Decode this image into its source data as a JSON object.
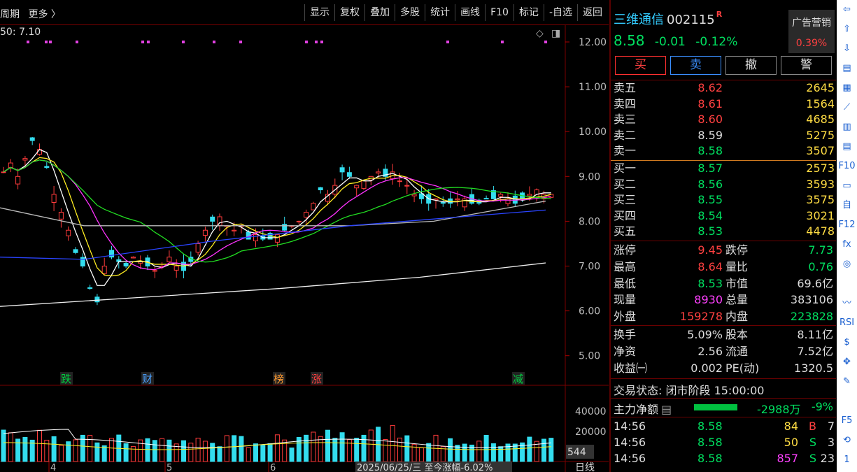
{
  "topbar": {
    "left_items": [
      "周期",
      "更多 〉"
    ],
    "tools": [
      "显示",
      "复权",
      "叠加",
      "多股",
      "统计",
      "画线",
      "F10",
      "标记",
      "-自选",
      "返回"
    ]
  },
  "chart": {
    "ma_readout": "50: 7.10",
    "price_axis": [
      "12.00",
      "11.00",
      "10.00",
      "9.00",
      "8.00",
      "7.00",
      "6.00",
      "5.00"
    ],
    "volume_axis": [
      "40000",
      "20000"
    ],
    "volume_current": "544",
    "x_labels": [
      "4",
      "5",
      "6"
    ],
    "date_readout": "2025/06/25/三  至今涨幅-6.02%",
    "period": "日线",
    "event_markers": [
      {
        "label": "跌",
        "color": "#00d040"
      },
      {
        "label": "财",
        "color": "#4aa0ff"
      },
      {
        "label": "榜",
        "color": "#ff9a30"
      },
      {
        "label": "涨",
        "color": "#ff4040"
      },
      {
        "label": "减",
        "color": "#00d040"
      }
    ]
  },
  "quote": {
    "name": "三维通信",
    "code": "002115",
    "r_mark": "R",
    "price": "8.58",
    "change": "-0.01",
    "change_pct": "-0.12%",
    "ad_label": "广告营销",
    "ad_pct": "0.39%",
    "buttons": [
      "买",
      "卖",
      "撤",
      "警"
    ]
  },
  "order_book": {
    "asks": [
      {
        "label": "卖五",
        "price": "8.62",
        "vol": "2645",
        "color": "#ff4040"
      },
      {
        "label": "卖四",
        "price": "8.61",
        "vol": "1564",
        "color": "#ff4040"
      },
      {
        "label": "卖三",
        "price": "8.60",
        "vol": "4685",
        "color": "#ff4040"
      },
      {
        "label": "卖二",
        "price": "8.59",
        "vol": "5275",
        "color": "#dddddd"
      },
      {
        "label": "卖一",
        "price": "8.58",
        "vol": "3507",
        "color": "#00e060"
      }
    ],
    "bids": [
      {
        "label": "买一",
        "price": "8.57",
        "vol": "2573",
        "color": "#00e060"
      },
      {
        "label": "买二",
        "price": "8.56",
        "vol": "3593",
        "color": "#00e060"
      },
      {
        "label": "买三",
        "price": "8.55",
        "vol": "3575",
        "color": "#00e060"
      },
      {
        "label": "买四",
        "price": "8.54",
        "vol": "3021",
        "color": "#00e060"
      },
      {
        "label": "买五",
        "price": "8.53",
        "vol": "4478",
        "color": "#00e060"
      }
    ]
  },
  "stats": [
    [
      {
        "k": "涨停",
        "v": "9.45",
        "c": "#ff4040"
      },
      {
        "k": "跌停",
        "v": "7.73",
        "c": "#00e060"
      }
    ],
    [
      {
        "k": "最高",
        "v": "8.64",
        "c": "#ff4040"
      },
      {
        "k": "量比",
        "v": "0.76",
        "c": "#00e060"
      }
    ],
    [
      {
        "k": "最低",
        "v": "8.53",
        "c": "#00e060"
      },
      {
        "k": "市值",
        "v": "69.6亿",
        "c": "#dddddd"
      }
    ],
    [
      {
        "k": "现量",
        "v": "8930",
        "c": "#ff40ff"
      },
      {
        "k": "总量",
        "v": "383106",
        "c": "#dddddd"
      }
    ],
    [
      {
        "k": "外盘",
        "v": "159278",
        "c": "#ff4040"
      },
      {
        "k": "内盘",
        "v": "223828",
        "c": "#00e060"
      }
    ],
    [
      {
        "k": "换手",
        "v": "5.09%",
        "c": "#dddddd"
      },
      {
        "k": "股本",
        "v": "8.11亿",
        "c": "#dddddd"
      }
    ],
    [
      {
        "k": "净资",
        "v": "2.56",
        "c": "#dddddd"
      },
      {
        "k": "流通",
        "v": "7.52亿",
        "c": "#dddddd"
      }
    ],
    [
      {
        "k": "收益㈠",
        "v": "0.002",
        "c": "#dddddd"
      },
      {
        "k": "PE(动)",
        "v": "1320.5",
        "c": "#dddddd"
      }
    ]
  ],
  "trade_status": "交易状态: 闭市阶段 15:00:00",
  "main_flow": {
    "label": "主力净额",
    "value": "-2988万",
    "pct": "-9%"
  },
  "ticks": [
    {
      "time": "14:56",
      "price": "8.58",
      "vol": "84",
      "vc": "#ffdd44",
      "side": "B",
      "sc": "#ff4040",
      "n": "7"
    },
    {
      "time": "14:56",
      "price": "8.58",
      "vol": "50",
      "vc": "#ffdd44",
      "side": "S",
      "sc": "#00e060",
      "n": "3"
    },
    {
      "time": "14:56",
      "price": "8.58",
      "vol": "857",
      "vc": "#ff40ff",
      "side": "S",
      "sc": "#00e060",
      "n": "23"
    }
  ],
  "strip_icons": [
    "⇦",
    "⇧",
    "⇩",
    "▤",
    "▦",
    "⟋",
    "▥",
    "▤",
    "F10",
    "▭",
    "自",
    "F12",
    "fx",
    "◎",
    "",
    "〰",
    "RSI",
    "$",
    "✥",
    "✎",
    "",
    "F5",
    "⟲",
    "1"
  ]
}
